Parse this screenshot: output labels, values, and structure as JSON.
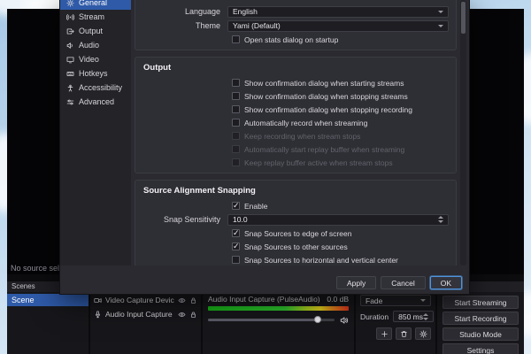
{
  "colors": {
    "accent_blue": "#2e5aa8",
    "focus_blue": "#4f94dd",
    "meter_green": "#2ec42e",
    "meter_yellow": "#e3d11c",
    "meter_red": "#e0341c"
  },
  "dialog": {
    "sidebar": {
      "items": [
        {
          "label": "General",
          "icon": "gear-icon",
          "selected": true
        },
        {
          "label": "Stream",
          "icon": "broadcast-icon",
          "selected": false
        },
        {
          "label": "Output",
          "icon": "output-icon",
          "selected": false
        },
        {
          "label": "Audio",
          "icon": "speaker-icon",
          "selected": false
        },
        {
          "label": "Video",
          "icon": "monitor-icon",
          "selected": false
        },
        {
          "label": "Hotkeys",
          "icon": "keyboard-icon",
          "selected": false
        },
        {
          "label": "Accessibility",
          "icon": "person-icon",
          "selected": false
        },
        {
          "label": "Advanced",
          "icon": "sliders-icon",
          "selected": false
        }
      ]
    },
    "general": {
      "language_label": "Language",
      "language_value": "English",
      "theme_label": "Theme",
      "theme_value": "Yami (Default)",
      "open_stats_label": "Open stats dialog on startup",
      "open_stats_checked": false
    },
    "output": {
      "title": "Output",
      "items": [
        {
          "label": "Show confirmation dialog when starting streams",
          "checked": false,
          "disabled": false
        },
        {
          "label": "Show confirmation dialog when stopping streams",
          "checked": false,
          "disabled": false
        },
        {
          "label": "Show confirmation dialog when stopping recording",
          "checked": false,
          "disabled": false
        },
        {
          "label": "Automatically record when streaming",
          "checked": false,
          "disabled": false
        },
        {
          "label": "Keep recording when stream stops",
          "checked": false,
          "disabled": true
        },
        {
          "label": "Automatically start replay buffer when streaming",
          "checked": false,
          "disabled": true
        },
        {
          "label": "Keep replay buffer active when stream stops",
          "checked": false,
          "disabled": true
        }
      ]
    },
    "snapping": {
      "title": "Source Alignment Snapping",
      "enable_label": "Enable",
      "enable_checked": true,
      "sensitivity_label": "Snap Sensitivity",
      "sensitivity_value": "10.0",
      "items": [
        {
          "label": "Snap Sources to edge of screen",
          "checked": true
        },
        {
          "label": "Snap Sources to other sources",
          "checked": true
        },
        {
          "label": "Snap Sources to horizontal and vertical center",
          "checked": false
        }
      ]
    },
    "footer": {
      "apply": "Apply",
      "cancel": "Cancel",
      "ok": "OK"
    }
  },
  "main": {
    "preview_hint": "No source selected",
    "scenes": {
      "header": "Scenes",
      "selected": "Scene"
    },
    "sources": {
      "rows": [
        {
          "label": "Video Capture Device",
          "icon": "camera-icon"
        },
        {
          "label": "Audio Input Capture (PulseAudio)",
          "icon": "microphone-icon"
        }
      ]
    },
    "mixer": {
      "name": "Audio Input Capture (PulseAudio)",
      "level": "0.0 dB"
    },
    "transitions": {
      "selected": "Fade",
      "duration_label": "Duration",
      "duration_value": "850 ms"
    },
    "controls": {
      "buttons": [
        "Start Streaming",
        "Start Recording",
        "Studio Mode",
        "Settings"
      ]
    }
  }
}
